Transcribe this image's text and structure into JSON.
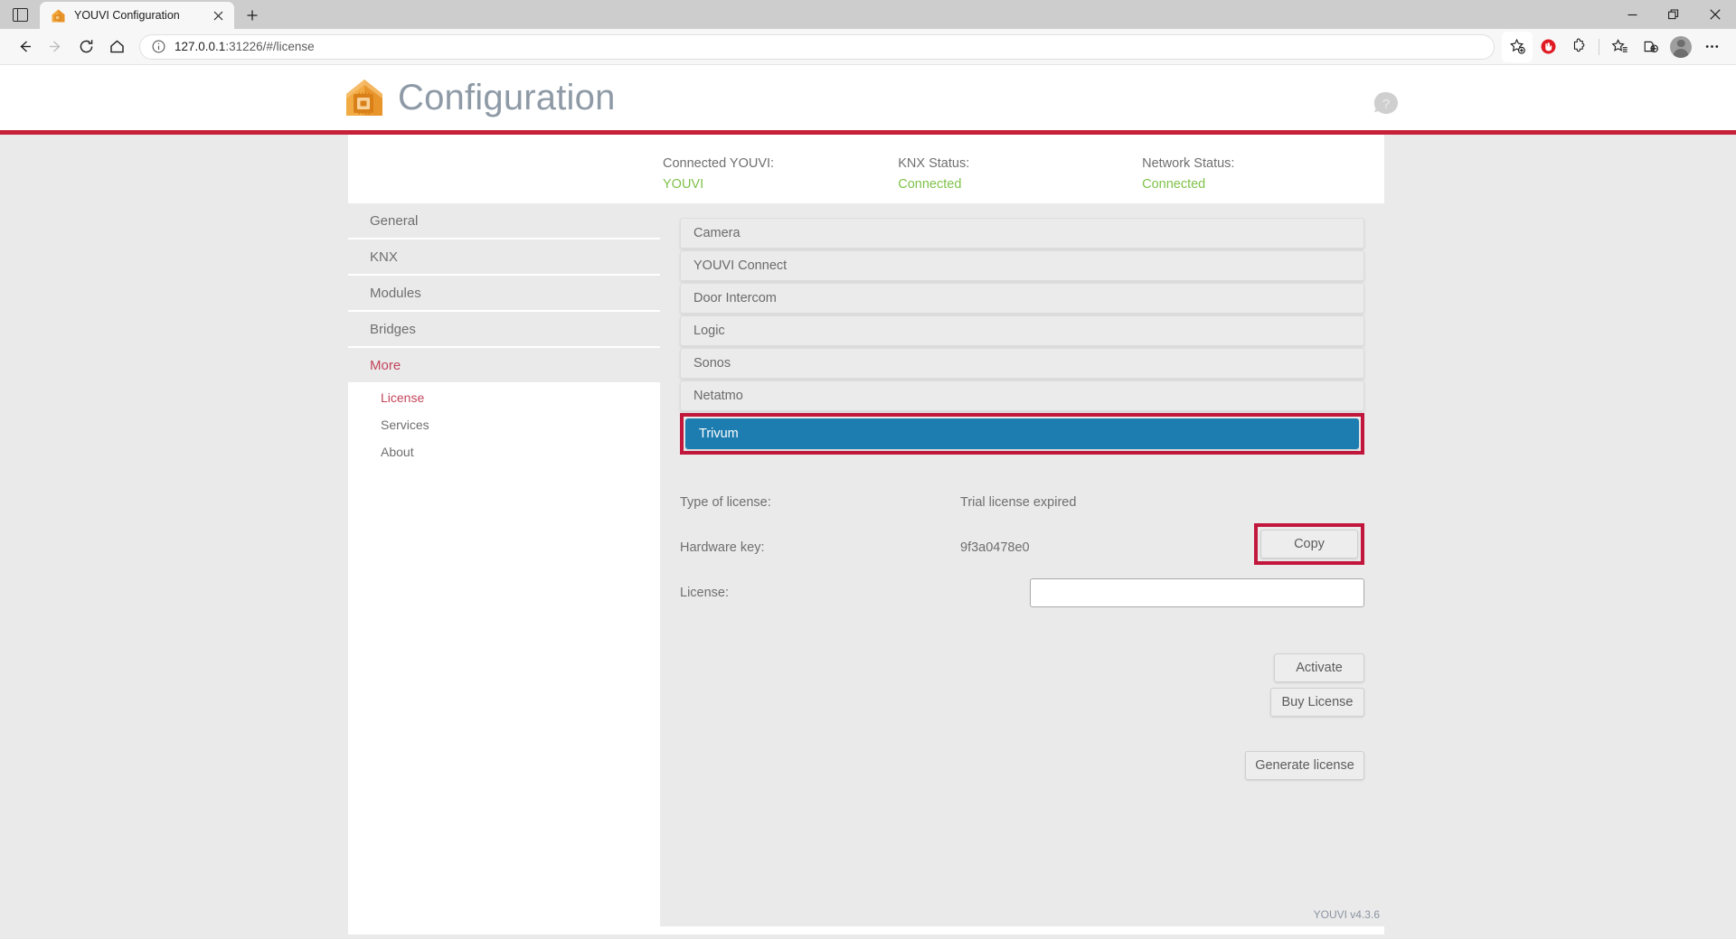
{
  "browser": {
    "tab": {
      "title": "YOUVI Configuration",
      "favicon_name": "youvi-house-icon",
      "close_label": "✕"
    },
    "new_tab_label": "+",
    "tab_list_icon": "tab-list-icon",
    "nav": {
      "back_label": "back-icon",
      "forward_label": "forward-icon",
      "reload_label": "reload-icon",
      "home_label": "home-icon"
    },
    "omnibox": {
      "info_icon": "info-icon",
      "url_host": "127.0.0.1",
      "url_path": ":31226/#/license",
      "full_url": "127.0.0.1:31226/#/license"
    },
    "toolbar_icons": [
      "add-favorite-icon",
      "adblock-shield-icon",
      "extensions-puzzle-icon",
      "favorites-list-icon",
      "collections-icon",
      "profile-avatar-icon",
      "more-settings-icon"
    ],
    "window_controls": {
      "minimize": "minimize-icon",
      "restore": "restore-icon",
      "close": "close-icon"
    }
  },
  "header": {
    "title": "Configuration",
    "logo_name": "youvi-house-chip-logo",
    "help_icon": "help-question-icon",
    "accent_color": "#c62139"
  },
  "status": [
    {
      "label": "Connected YOUVI:",
      "value": "YOUVI"
    },
    {
      "label": "KNX Status:",
      "value": "Connected"
    },
    {
      "label": "Network Status:",
      "value": "Connected"
    }
  ],
  "sidebar": {
    "items": [
      {
        "label": "General",
        "active": false
      },
      {
        "label": "KNX",
        "active": false
      },
      {
        "label": "Modules",
        "active": false
      },
      {
        "label": "Bridges",
        "active": false
      },
      {
        "label": "More",
        "active": true
      }
    ],
    "subitems": [
      {
        "label": "License",
        "active": true
      },
      {
        "label": "Services",
        "active": false
      },
      {
        "label": "About",
        "active": false
      }
    ]
  },
  "license_list": [
    {
      "label": "Camera",
      "selected": false
    },
    {
      "label": "YOUVI Connect",
      "selected": false
    },
    {
      "label": "Door Intercom",
      "selected": false
    },
    {
      "label": "Logic",
      "selected": false
    },
    {
      "label": "Sonos",
      "selected": false
    },
    {
      "label": "Netatmo",
      "selected": false
    },
    {
      "label": "Trivum",
      "selected": true
    }
  ],
  "details": {
    "type_label": "Type of license:",
    "type_value": "Trial license expired",
    "hardware_label": "Hardware key:",
    "hardware_value": "9f3a0478e0",
    "copy_label": "Copy",
    "license_label": "License:",
    "license_value": "",
    "license_placeholder": ""
  },
  "actions": {
    "activate_label": "Activate",
    "buy_label": "Buy License",
    "generate_label": "Generate license"
  },
  "footer": {
    "version": "YOUVI v4.3.6"
  },
  "annotations": {
    "highlight_color": "#c2173c",
    "selected_row_color": "#1e7db0"
  }
}
